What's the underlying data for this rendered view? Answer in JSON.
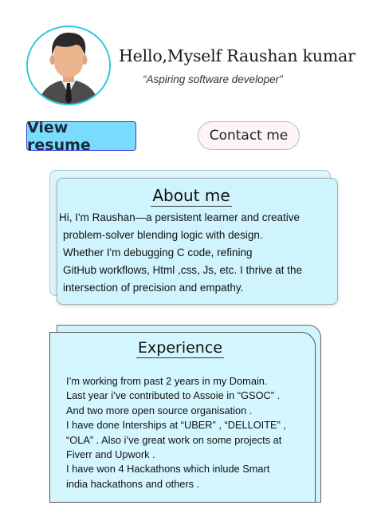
{
  "header": {
    "name": "Hello,Myself Raushan kumar",
    "tagline": "“Aspiring software developer”"
  },
  "avatar": {
    "icon": "person-avatar-icon",
    "ring_color": "#27c9dd"
  },
  "buttons": {
    "resume_label": "View resume",
    "contact_label": "Contact me"
  },
  "about": {
    "title": "About me",
    "lines": [
      "Hi, I'm Raushan—a persistent learner and creative",
      "problem-solver blending logic with design.",
      "Whether I'm debugging C code, refining",
      "GitHub workflows, Html ,css, Js, etc. I thrive at the",
      "intersection of precision and empathy."
    ]
  },
  "experience": {
    "title": "Experience",
    "lines": [
      "I’m working from past 2 years in my Domain.",
      "Last year i’ve contributed to Assoie in  “GSOC”  .",
      "And two more open source organisation .",
      "I have done Interships at “UBER” , “DELLOITE” ,",
      "“OLA” . Also i’ve great work on some projects at",
      "Fiverr and Upwork .",
      "I have won 4 Hackathons which inlude Smart",
      "india hackathons and others ."
    ]
  },
  "colors": {
    "card_bg": "#d0f4fd",
    "resume_button": "#79dcff",
    "resume_border": "#3a3ad8"
  }
}
